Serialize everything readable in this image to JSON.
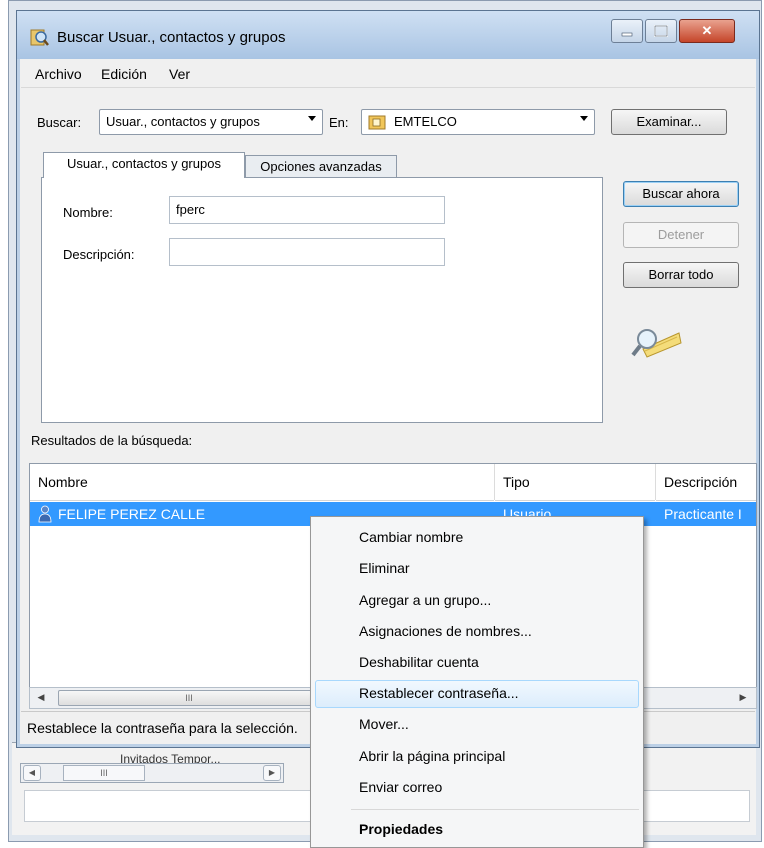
{
  "window": {
    "title": "Buscar Usuar., contactos y grupos"
  },
  "menubar": {
    "items": [
      "Archivo",
      "Edición",
      "Ver"
    ]
  },
  "search": {
    "buscar_label": "Buscar:",
    "buscar_value": "Usuar., contactos y grupos",
    "en_label": "En:",
    "en_value": "EMTELCO",
    "examinar_label": "Examinar..."
  },
  "tabs": [
    "Usuar., contactos y grupos",
    "Opciones avanzadas"
  ],
  "form": {
    "nombre_label": "Nombre:",
    "nombre_value": "fperc",
    "descripcion_label": "Descripción:",
    "descripcion_value": ""
  },
  "actions": {
    "buscar_ahora": "Buscar ahora",
    "detener": "Detener",
    "borrar_todo": "Borrar todo"
  },
  "results": {
    "label": "Resultados de la búsqueda:",
    "columns": [
      "Nombre",
      "Tipo",
      "Descripción"
    ],
    "rows": [
      {
        "nombre": "FELIPE PEREZ CALLE",
        "tipo": "Usuario",
        "descripcion": "Practicante I"
      }
    ]
  },
  "scrollbar": {
    "thumb_glyph": "III"
  },
  "status": {
    "text": "Restablece la contraseña para la selección."
  },
  "context_menu": {
    "items": [
      {
        "label": "Cambiar nombre"
      },
      {
        "label": "Eliminar"
      },
      {
        "label": "Agregar a un grupo..."
      },
      {
        "label": "Asignaciones de nombres..."
      },
      {
        "label": "Deshabilitar cuenta"
      },
      {
        "label": "Restablecer contraseña..."
      },
      {
        "label": "Mover..."
      },
      {
        "label": "Abrir la página principal"
      },
      {
        "label": "Enviar correo"
      },
      {
        "label": "Propiedades"
      }
    ]
  },
  "background_window": {
    "partial_text": "Invitados Tempor..."
  },
  "colors": {
    "selection": "#3399ff",
    "titlebar": "#a9c4e3",
    "close_button": "#c5452a",
    "menu_hover_border": "#a8d8fd"
  }
}
